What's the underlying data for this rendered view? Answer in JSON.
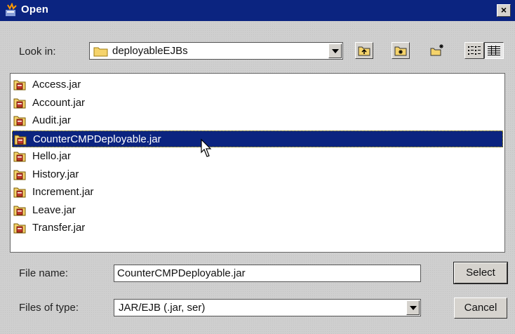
{
  "window": {
    "title": "Open",
    "close_label": "×"
  },
  "toolbar": {
    "look_in_label": "Look in:",
    "look_in_value": "deployableEJBs",
    "buttons": [
      "up-one-level",
      "home",
      "new-folder",
      "list-view",
      "details-view"
    ]
  },
  "files": [
    {
      "name": "Access.jar"
    },
    {
      "name": "Account.jar"
    },
    {
      "name": "Audit.jar"
    },
    {
      "name": "CounterCMPDeployable.jar",
      "selected": true
    },
    {
      "name": "Hello.jar"
    },
    {
      "name": "History.jar"
    },
    {
      "name": "Increment.jar"
    },
    {
      "name": "Leave.jar"
    },
    {
      "name": "Transfer.jar"
    }
  ],
  "form": {
    "file_name_label": "File name:",
    "file_name_value": "CounterCMPDeployable.jar",
    "file_type_label": "Files of type:",
    "file_type_value": "JAR/EJB (.jar, ser)"
  },
  "actions": {
    "select_label": "Select",
    "cancel_label": "Cancel"
  },
  "colors": {
    "titlebar": "#0b2480",
    "selection": "#0b2480",
    "panel": "#cfcfcf"
  }
}
